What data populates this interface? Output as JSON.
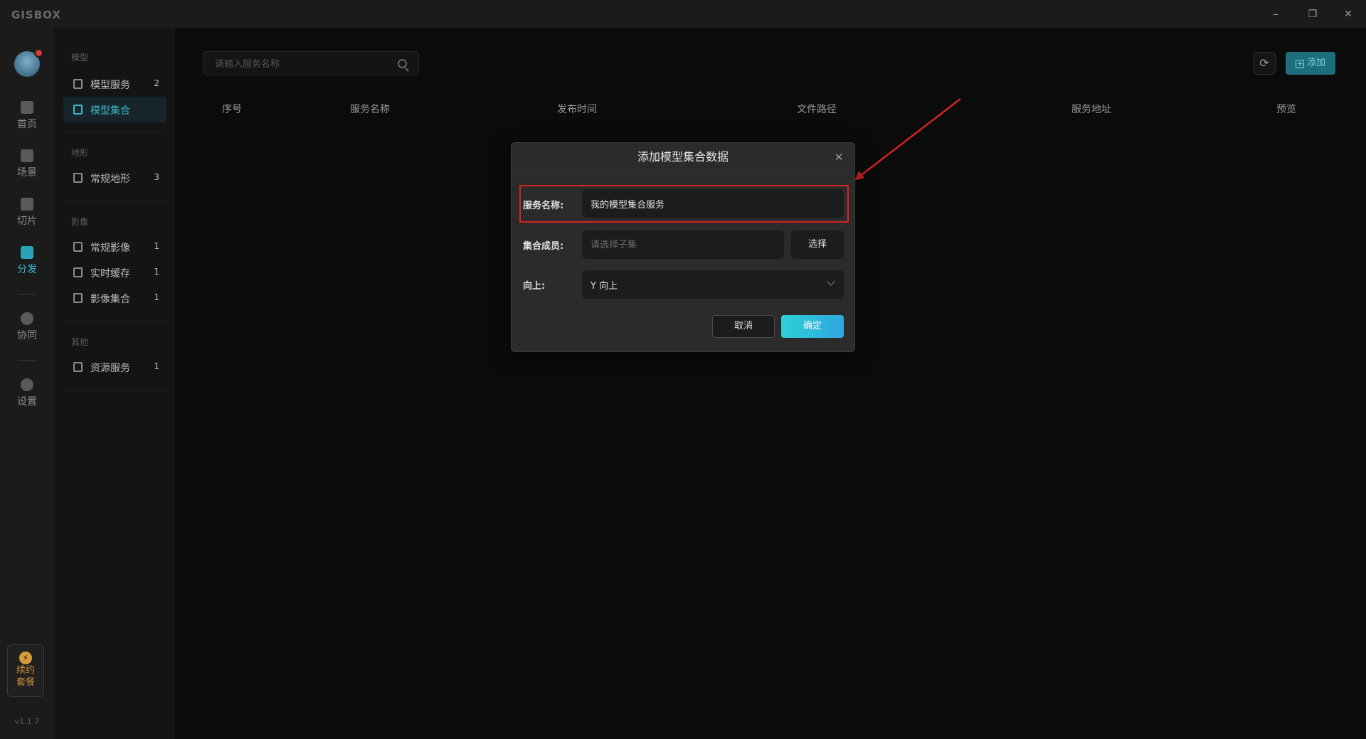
{
  "app": {
    "logo": "GISBOX",
    "version": "v1.1.7"
  },
  "window_controls": {
    "minimize": "–",
    "restore": "❐",
    "close": "✕"
  },
  "rail": {
    "items": [
      {
        "label": "首页",
        "icon": "home-icon"
      },
      {
        "label": "场景",
        "icon": "cube-icon"
      },
      {
        "label": "切片",
        "icon": "slice-icon"
      },
      {
        "label": "分发",
        "icon": "distribute-icon",
        "active": true
      },
      {
        "label": "协同",
        "icon": "lock-icon"
      },
      {
        "label": "设置",
        "icon": "gear-icon"
      }
    ],
    "renew": {
      "line1": "续约",
      "line2": "套餐",
      "icon": "lightning-icon"
    }
  },
  "categories": {
    "model": {
      "header": "模型",
      "items": [
        {
          "label": "模型服务",
          "count": "2"
        },
        {
          "label": "模型集合",
          "count": "",
          "active": true
        }
      ]
    },
    "terrain": {
      "header": "地形",
      "items": [
        {
          "label": "常规地形",
          "count": "3"
        }
      ]
    },
    "imagery": {
      "header": "影像",
      "items": [
        {
          "label": "常规影像",
          "count": "1"
        },
        {
          "label": "实时缓存",
          "count": "1"
        },
        {
          "label": "影像集合",
          "count": "1"
        }
      ]
    },
    "other": {
      "header": "其他",
      "items": [
        {
          "label": "资源服务",
          "count": "1"
        }
      ]
    }
  },
  "toolbar": {
    "search_placeholder": "请输入服务名称",
    "add_label": "添加"
  },
  "table": {
    "headers": [
      "序号",
      "服务名称",
      "发布时间",
      "文件路径",
      "服务地址",
      "预览"
    ]
  },
  "dialog": {
    "title": "添加模型集合数据",
    "service_name_label": "服务名称:",
    "service_name_value": "我的模型集合服务",
    "members_label": "集合成员:",
    "members_placeholder": "请选择子集",
    "choose_label": "选择",
    "up_label": "向上:",
    "up_value": "Y 向上",
    "cancel_label": "取消",
    "ok_label": "确定"
  },
  "colors": {
    "accent": "#2aa3b7",
    "annotation": "#d42424",
    "ok_gradient_start": "#2fd0d6",
    "ok_gradient_end": "#2fa6df"
  }
}
